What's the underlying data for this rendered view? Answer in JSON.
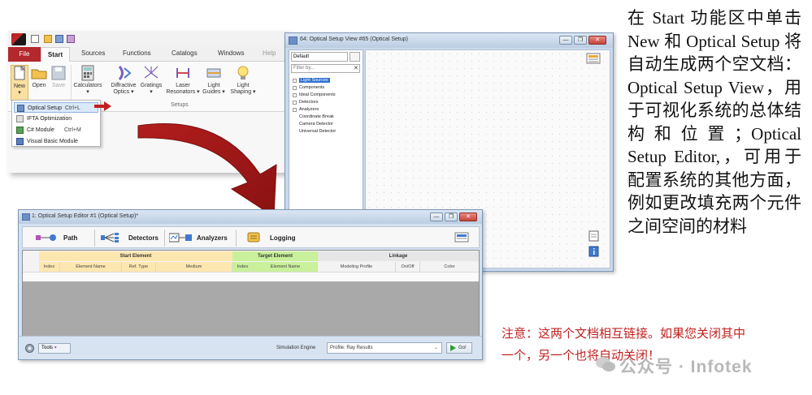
{
  "ribbon": {
    "tabs": [
      "File",
      "Start",
      "Sources",
      "Functions",
      "Catalogs",
      "Windows",
      "Help"
    ],
    "buttons": [
      {
        "label": "New",
        "sub": "▾"
      },
      {
        "label": "Open",
        "sub": ""
      },
      {
        "label": "Save",
        "sub": ""
      },
      {
        "label": "Calculators",
        "sub": "▾"
      },
      {
        "label": "Diffractive",
        "sub": "Optics ▾"
      },
      {
        "label": "Gratings",
        "sub": "▾"
      },
      {
        "label": "Laser",
        "sub": "Resonators ▾"
      },
      {
        "label": "Light",
        "sub": "Guides ▾"
      },
      {
        "label": "Light",
        "sub": "Shaping ▾"
      }
    ],
    "group_label": "Setups",
    "new_menu": [
      {
        "label": "Optical Setup",
        "shortcut": "Ctrl+L"
      },
      {
        "label": "IFTA Optimization",
        "shortcut": ""
      },
      {
        "label": "C# Module",
        "shortcut": "Ctrl+M"
      },
      {
        "label": "Visual Basic Module",
        "shortcut": ""
      }
    ]
  },
  "view_window": {
    "title": "64: Optical Setup View #65 (Optical Setup)",
    "combo_value": "Default",
    "filter_placeholder": "Filter by...",
    "tree": [
      "Light Sources",
      "Components",
      "Ideal Components",
      "Detectors",
      "Analyzers",
      "Coordinate Break",
      "Camera Detector",
      "Universal Detector"
    ],
    "window_buttons": [
      "—",
      "❐",
      "✕"
    ]
  },
  "editor_window": {
    "title": "1: Optical Setup Editor #1 (Optical Setup)*",
    "tabs": [
      "Path",
      "Detectors",
      "Analyzers",
      "Logging"
    ],
    "groups": [
      "Start Element",
      "Target Element",
      "Linkage"
    ],
    "columns": [
      "Index",
      "Element Name",
      "Ref. Type",
      "Medium",
      "Index",
      "Element Name",
      "Modeling Profile",
      "On/Off",
      "Color"
    ],
    "tools_label": "Tools",
    "sim_engine_label": "Simulation Engine",
    "sim_engine_value": "Profile: Ray Results",
    "go_label": "Go!",
    "window_buttons": [
      "—",
      "❐",
      "✕"
    ]
  },
  "caption_main": "在 Start 功能区中单击 New 和 Optical Setup 将自动生成两个空文档：Optical Setup View，用于可视化系统的总体结构和位置；Optical Setup Editor,，可用于配置系统的其他方面，例如更改填充两个元件之间空间的材料",
  "caption_note": "注意：这两个文档相互链接。如果您关闭其中一个，另一个也将自动关闭！",
  "watermark": "公众号 · Infotek",
  "colors": {
    "accent_red": "#c21f1f",
    "file_tab": "#b3282d",
    "start_group": "#fde7b0",
    "target_group": "#c9f09a",
    "linkage_group": "#e6e6e6"
  }
}
